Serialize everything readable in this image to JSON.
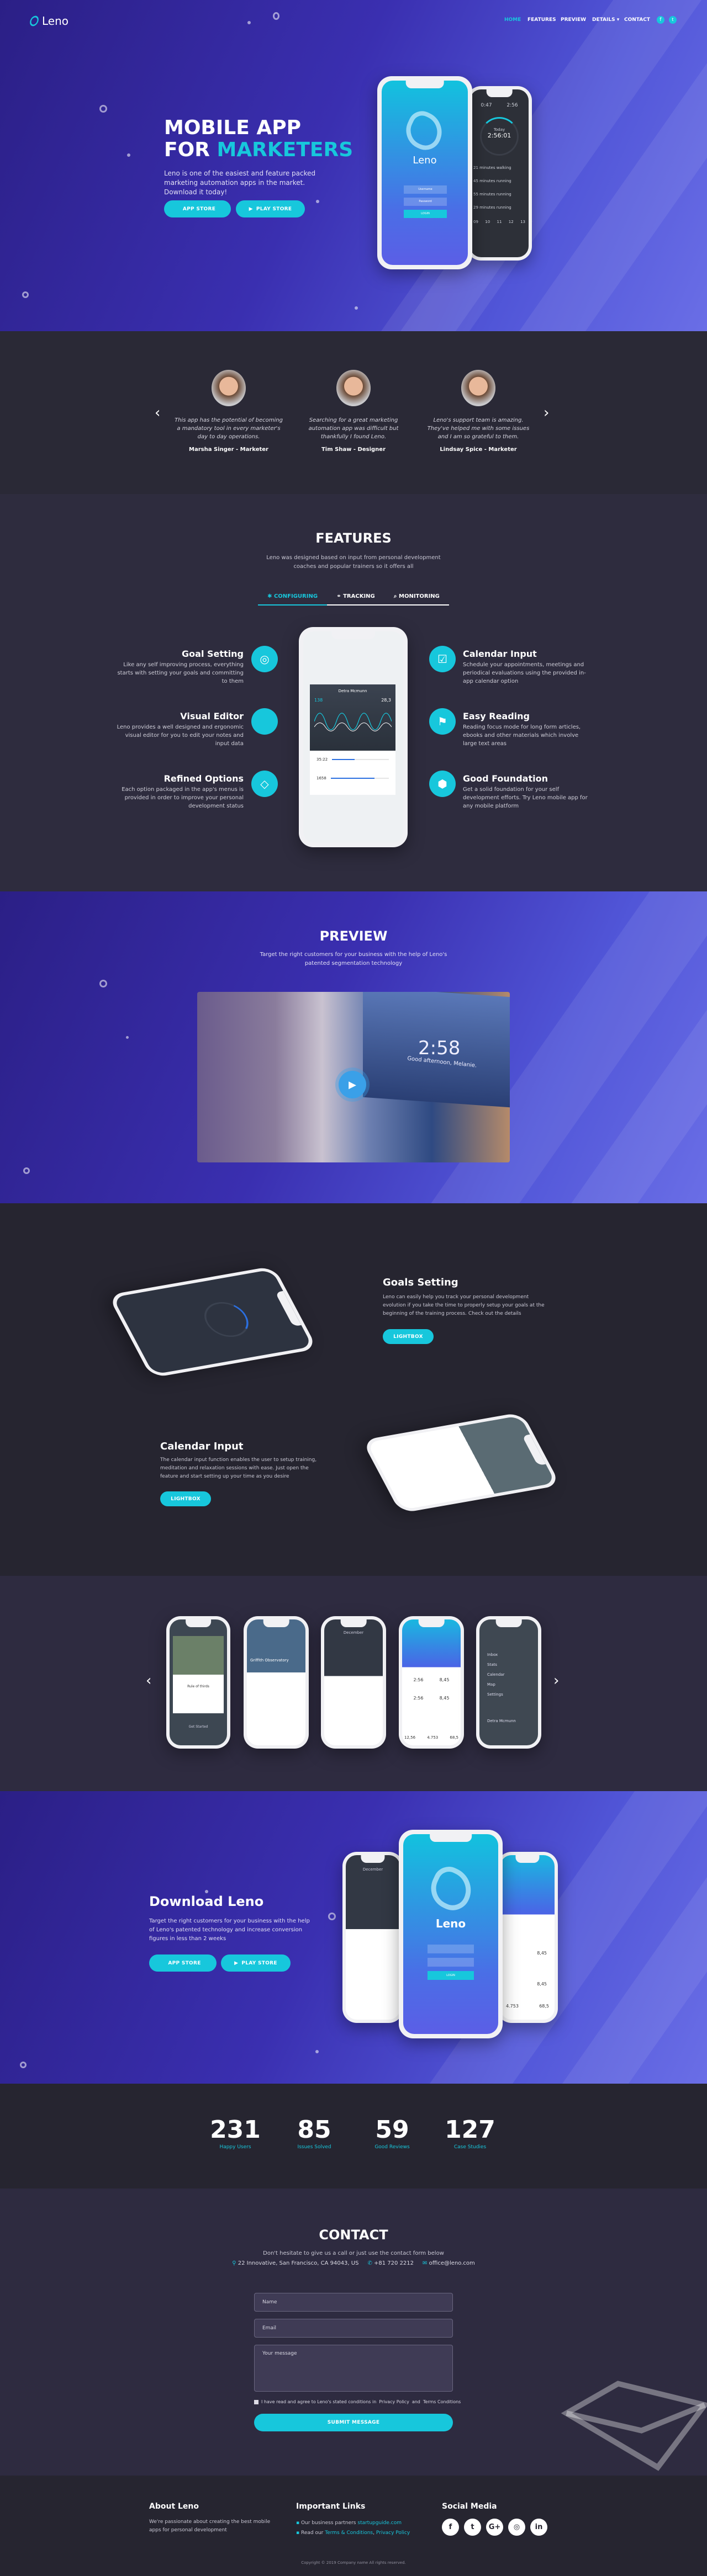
{
  "colors": {
    "accent": "#17c7dc",
    "dark": "#262530",
    "dark_alt": "#2e2b40",
    "purple": "#3a2fb0"
  },
  "nav": {
    "logo": "Leno",
    "items": [
      "HOME",
      "FEATURES",
      "PREVIEW",
      "DETAILS",
      "CONTACT"
    ],
    "active": "HOME",
    "social_icons": [
      "facebook-icon",
      "twitter-icon"
    ]
  },
  "hero": {
    "title_line1": "MOBILE APP",
    "title_line2_prefix": "FOR",
    "title_line2_accent": "MARKETERS",
    "description": "Leno is one of the easiest and feature packed marketing automation apps in the market. Download it today!",
    "app_store": "APP STORE",
    "play_store": "PLAY STORE",
    "phone_front": {
      "brand": "Leno",
      "username": "Username",
      "password": "Password",
      "login": "LOGIN"
    },
    "phone_back": {
      "stat1": "0:47",
      "stat2": "2:56",
      "today": "Today",
      "timer": "2:56:01",
      "items": [
        "21 minutes walking",
        "45 minutes running",
        "55 minutes running",
        "29 minutes running"
      ],
      "days": [
        "09",
        "10",
        "11",
        "12",
        "13"
      ]
    }
  },
  "testimonials": [
    {
      "quote": "This app has the potential of becoming a mandatory tool in every marketer's day to day operations.",
      "author": "Marsha Singer - Marketer"
    },
    {
      "quote": "Searching for a great marketing automation app was difficult but thankfully I found Leno.",
      "author": "Tim Shaw - Designer"
    },
    {
      "quote": "Leno's support team is amazing. They've helped me with some issues and I am so grateful to them.",
      "author": "Lindsay Spice - Marketer"
    }
  ],
  "features": {
    "title": "FEATURES",
    "subtitle": "Leno was designed based on input from personal development coaches and popular trainers so it offers all",
    "tabs": [
      {
        "label": "CONFIGURING",
        "icon": "gear-icon",
        "active": true
      },
      {
        "label": "TRACKING",
        "icon": "binoculars-icon",
        "active": false
      },
      {
        "label": "MONITORING",
        "icon": "search-icon",
        "active": false
      }
    ],
    "left": [
      {
        "title": "Goal Setting",
        "text": "Like any self improving process, everything starts with setting your goals and committing to them",
        "icon": "compass-icon"
      },
      {
        "title": "Visual Editor",
        "text": "Leno provides a well designed and ergonomic visual editor for you to edit your notes and input data",
        "icon": "code-file-icon"
      },
      {
        "title": "Refined Options",
        "text": "Each option packaged in the app's menus is provided in order to improve your personal development status",
        "icon": "diamond-icon"
      }
    ],
    "right": [
      {
        "title": "Calendar Input",
        "text": "Schedule your appointments, meetings and periodical evaluations using the provided in-app calendar option",
        "icon": "calendar-check-icon"
      },
      {
        "title": "Easy Reading",
        "text": "Reading focus mode for long form articles, ebooks and other materials which involve large text areas",
        "icon": "bookmark-icon"
      },
      {
        "title": "Good Foundation",
        "text": "Get a solid foundation for your self development efforts. Try Leno mobile app for any mobile platform",
        "icon": "cube-icon"
      }
    ],
    "phone": {
      "name": "Detra Mcmunn",
      "left_val": "138",
      "right_val": "28,3",
      "row1": "35:22",
      "row2": "1658",
      "row1_fill": 0.4,
      "row2_fill": 0.75
    }
  },
  "preview": {
    "title": "PREVIEW",
    "subtitle": "Target the right customers for your business with the help of Leno's patented segmentation technology",
    "video_clock": "2:58",
    "video_greeting": "Good afternoon, Melanie."
  },
  "details": [
    {
      "title": "Goals Setting",
      "text": "Leno can easily help you track your personal development evolution if you take the time to properly setup your goals at the beginning of the training process. Check out the details",
      "button": "LIGHTBOX"
    },
    {
      "title": "Calendar Input",
      "text": "The calendar input function enables the user to setup training, meditation and relaxation sessions with ease. Just open the feature and start setting up your time as you desire",
      "button": "LIGHTBOX"
    }
  ],
  "gallery": {
    "screens": [
      {
        "title": "Rule of thirds",
        "action": "Get Started"
      },
      {
        "title": "Griffith Observatory"
      },
      {
        "title": "December"
      },
      {
        "stats": [
          "2:56",
          "8,45",
          "2:56",
          "8,45"
        ],
        "bottom": [
          "12,56",
          "4.753",
          "68,5"
        ]
      },
      {
        "menu": [
          "Inbox",
          "Stats",
          "Calendar",
          "Map",
          "Settings"
        ],
        "user": "Detra Mcmunn"
      }
    ]
  },
  "download": {
    "title": "Download Leno",
    "text": "Target the right customers for your business with the help of Leno's patented technology and increase conversion figures in less than 2 weeks",
    "app_store": "APP STORE",
    "play_store": "PLAY STORE",
    "calendar_month": "December",
    "center_brand": "Leno",
    "login": "LOGIN",
    "right_values": [
      "8,45",
      "8,45",
      "4.753",
      "68,5"
    ]
  },
  "counters": [
    {
      "value": "231",
      "label": "Happy Users"
    },
    {
      "value": "85",
      "label": "Issues Solved"
    },
    {
      "value": "59",
      "label": "Good Reviews"
    },
    {
      "value": "127",
      "label": "Case Studies"
    }
  ],
  "contact": {
    "title": "CONTACT",
    "subtitle": "Don't hesitate to give us a call or just use the contact form below",
    "address": "22 Innovative, San Francisco, CA 94043, US",
    "phone": "+81 720 2212",
    "email": "office@leno.com",
    "form": {
      "name_placeholder": "Name",
      "email_placeholder": "Email",
      "message_placeholder": "Your message",
      "agree_prefix": "I have read and agree to Leno's stated conditions in",
      "privacy": "Privacy Policy",
      "and": "and",
      "terms": "Terms Conditions",
      "submit": "SUBMIT MESSAGE"
    }
  },
  "footer": {
    "about_title": "About Leno",
    "about_text": "We're passionate about creating the best mobile apps for personal development",
    "links_title": "Important Links",
    "link1_prefix": "Our business partners",
    "link1": "startupguide.com",
    "link2_prefix": "Read our",
    "link2a": "Terms & Conditions",
    "link2b": "Privacy Policy",
    "social_title": "Social Media",
    "social": [
      {
        "icon": "facebook-icon",
        "glyph": "f"
      },
      {
        "icon": "twitter-icon",
        "glyph": "t"
      },
      {
        "icon": "google-plus-icon",
        "glyph": "G+"
      },
      {
        "icon": "instagram-icon",
        "glyph": "◎"
      },
      {
        "icon": "linkedin-icon",
        "glyph": "in"
      }
    ],
    "copyright": "Copyright © 2019 Company name All rights reserved."
  }
}
